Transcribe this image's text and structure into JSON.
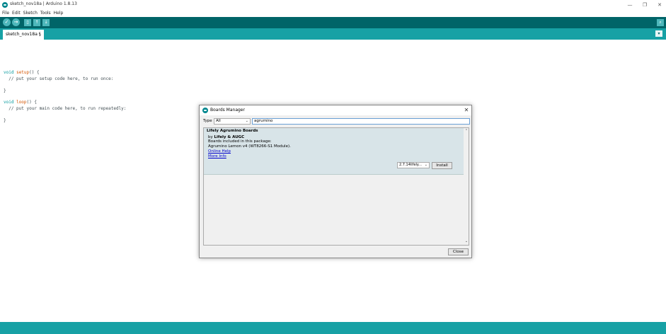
{
  "window": {
    "title": "sketch_nov18a | Arduino 1.8.13",
    "min_glyph": "—",
    "max_glyph": "❐",
    "close_glyph": "✕"
  },
  "menu": [
    "File",
    "Edit",
    "Sketch",
    "Tools",
    "Help"
  ],
  "toolbar": {
    "verify_glyph": "✓",
    "upload_glyph": "→",
    "new_glyph": "▯",
    "open_glyph": "↑",
    "save_glyph": "↓",
    "serial_glyph": "⌕"
  },
  "tab": {
    "label": "sketch_nov18a §",
    "menu_glyph": "▾"
  },
  "code": {
    "line1_kw": "void",
    "line1_fn": "setup",
    "line1_rest": "() {",
    "line2": "  // put your setup code here, to run once:",
    "line3": "}",
    "line4_kw": "void",
    "line4_fn": "loop",
    "line4_rest": "() {",
    "line5": "  // put your main code here, to run repeatedly:",
    "line6": "}"
  },
  "dialog": {
    "title": "Boards Manager",
    "close_glyph": "✕",
    "type_label": "Type",
    "type_value": "All",
    "search_value": "agrumino",
    "entry": {
      "name": "Lifely Agrumino Boards",
      "by_prefix": "by",
      "by_author": "Lifely & AUGC",
      "included_label": "Boards included in this package:",
      "boards": "Agrumino Lemon v4 (WT8266-S1 Module).",
      "online_help": "Online Help",
      "more_info": "More Info",
      "version": "2.7.14lifely...",
      "install_label": "Install"
    },
    "close_label": "Close"
  }
}
